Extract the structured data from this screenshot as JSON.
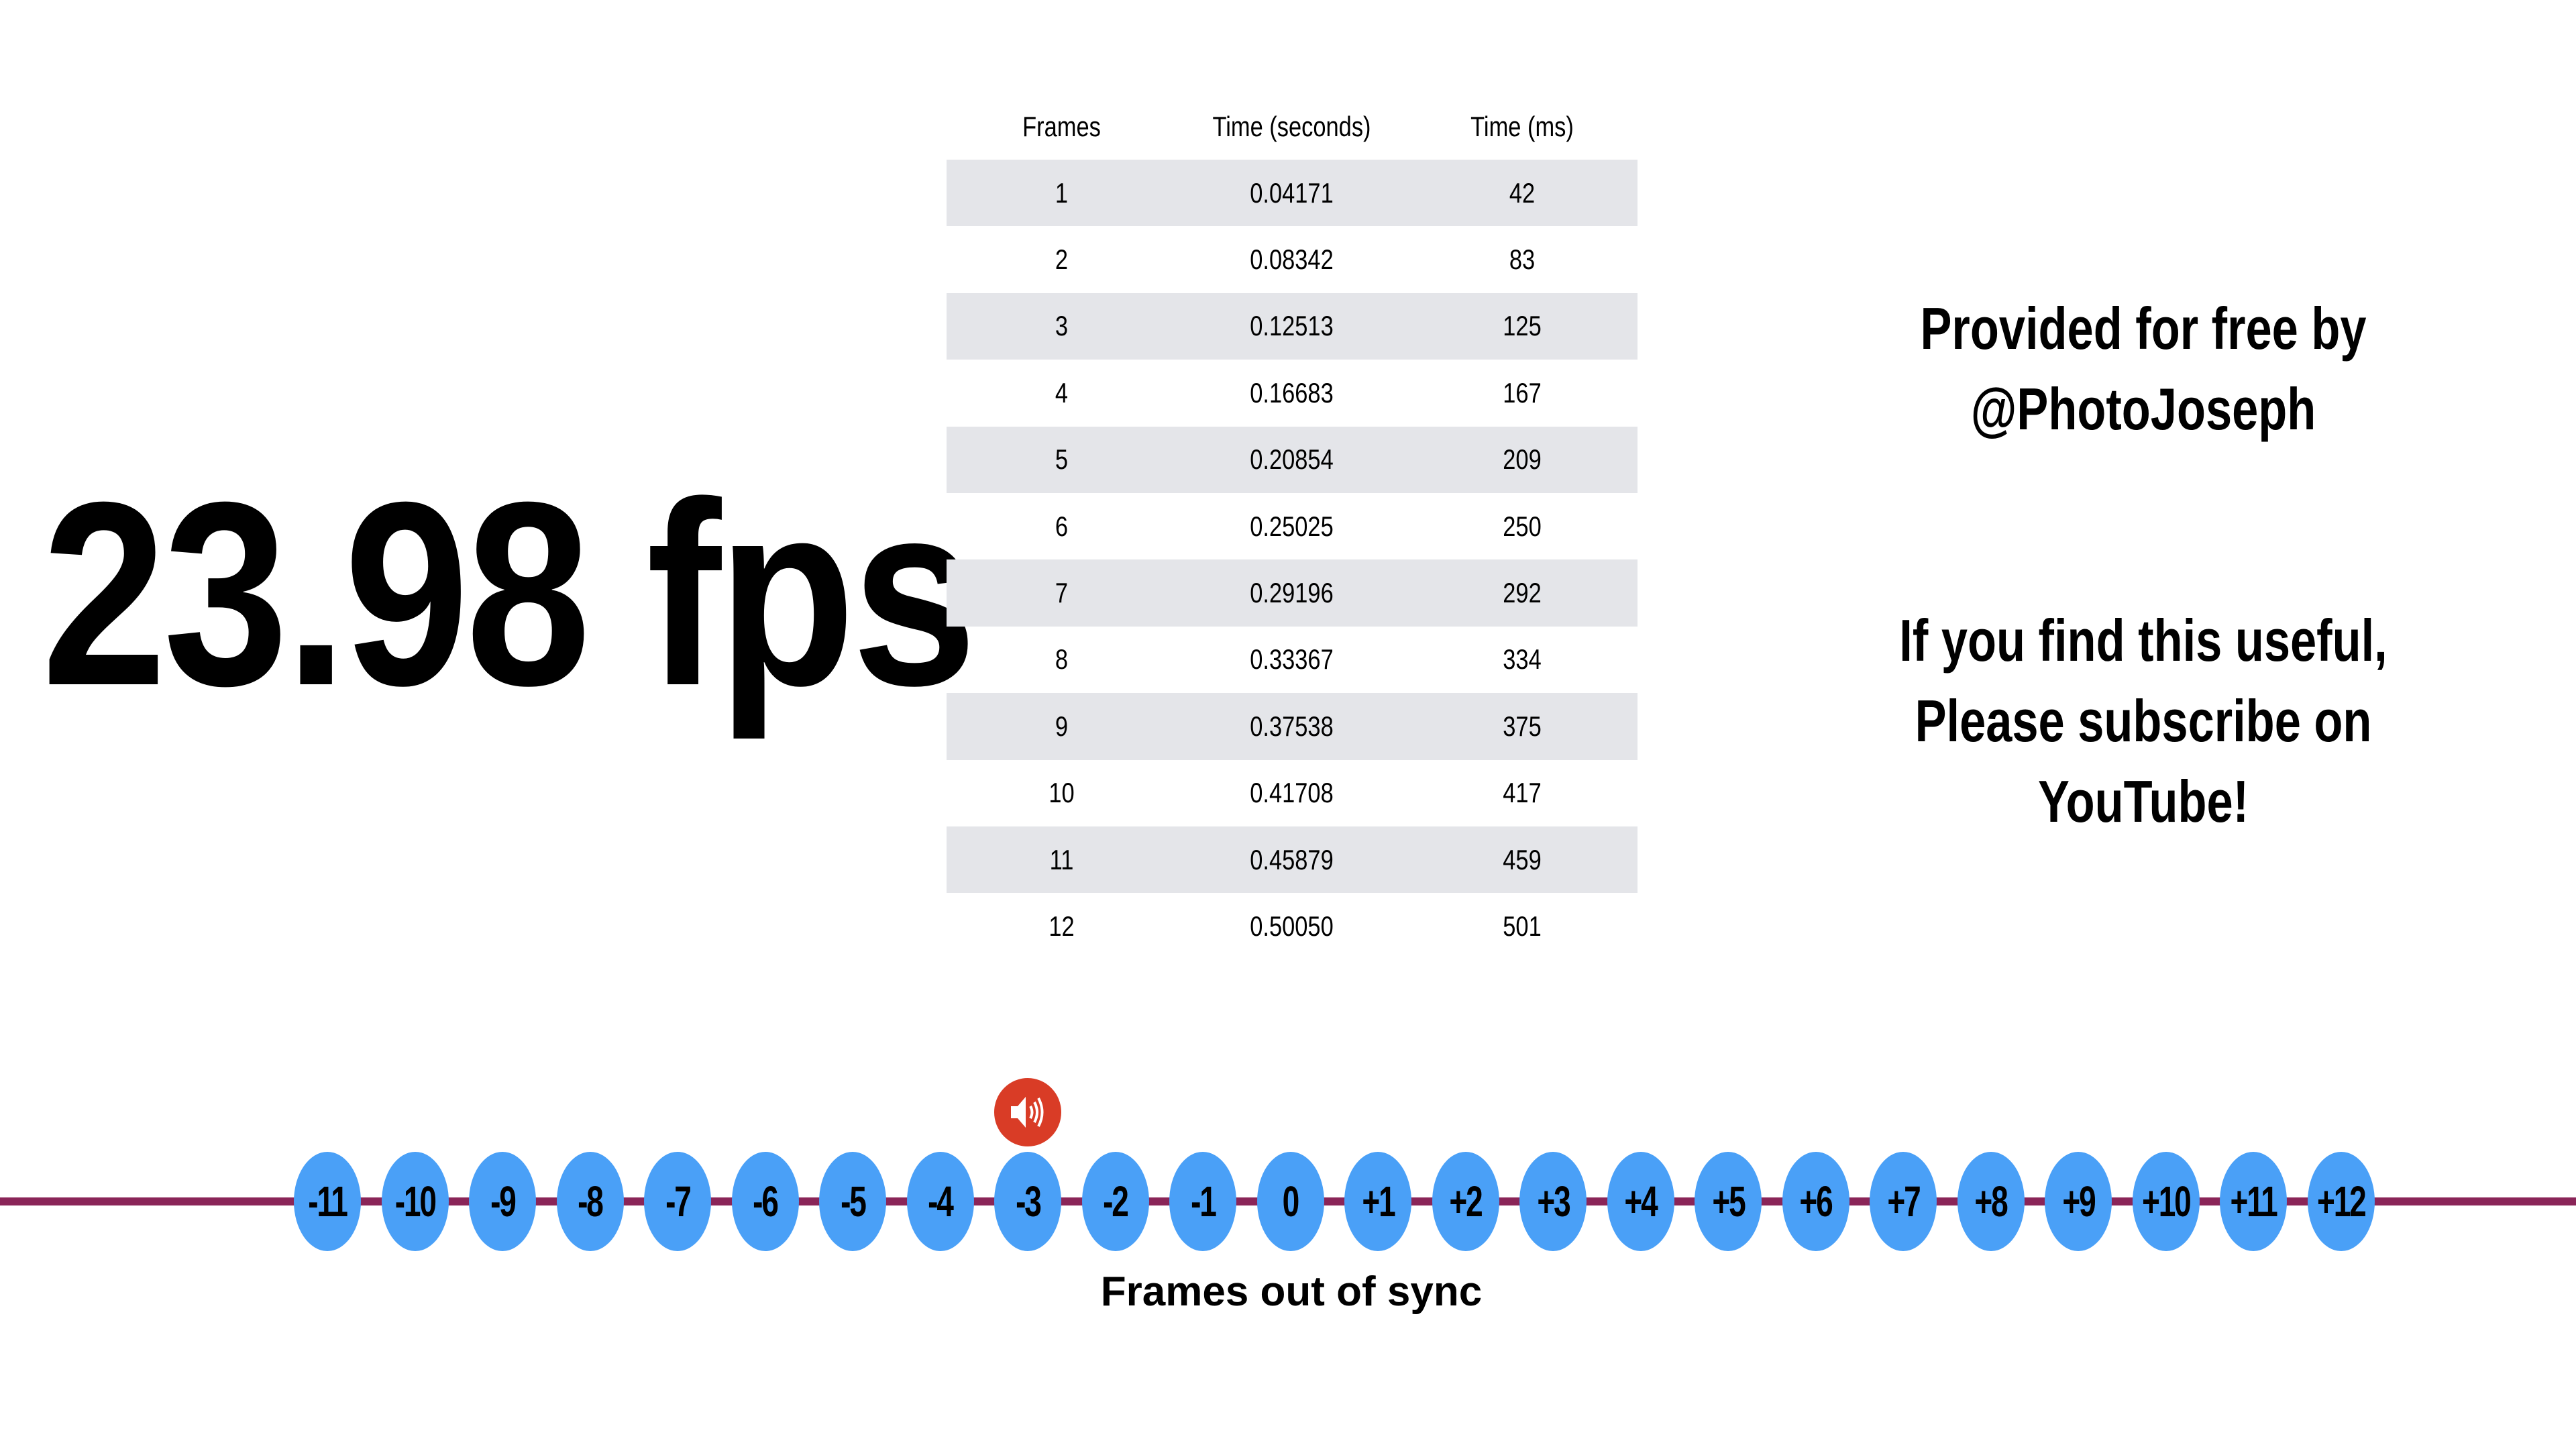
{
  "title": "23.98 fps",
  "table": {
    "headers": [
      "Frames",
      "Time (seconds)",
      "Time (ms)"
    ],
    "rows": [
      [
        "1",
        "0.04171",
        "42"
      ],
      [
        "2",
        "0.08342",
        "83"
      ],
      [
        "3",
        "0.12513",
        "125"
      ],
      [
        "4",
        "0.16683",
        "167"
      ],
      [
        "5",
        "0.20854",
        "209"
      ],
      [
        "6",
        "0.25025",
        "250"
      ],
      [
        "7",
        "0.29196",
        "292"
      ],
      [
        "8",
        "0.33367",
        "334"
      ],
      [
        "9",
        "0.37538",
        "375"
      ],
      [
        "10",
        "0.41708",
        "417"
      ],
      [
        "11",
        "0.45879",
        "459"
      ],
      [
        "12",
        "0.50050",
        "501"
      ]
    ]
  },
  "credit": {
    "line1": "Provided for free by",
    "line2": "@PhotoJoseph"
  },
  "cta": {
    "line1": "If you find this useful,",
    "line2": "Please subscribe on YouTube!"
  },
  "timeline": {
    "labels": [
      "-11",
      "-10",
      "-9",
      "-8",
      "-7",
      "-6",
      "-5",
      "-4",
      "-3",
      "-2",
      "-1",
      "0",
      "+1",
      "+2",
      "+3",
      "+4",
      "+5",
      "+6",
      "+7",
      "+8",
      "+9",
      "+10",
      "+11",
      "+12"
    ],
    "audio_marker_at": "-3",
    "axis_label": "Frames out of sync",
    "icon": "speaker-icon"
  },
  "colors": {
    "row_shade": "#e4e5e9",
    "line": "#8a2558",
    "dot": "#4aa0f7",
    "audio_marker": "#d93c26"
  }
}
